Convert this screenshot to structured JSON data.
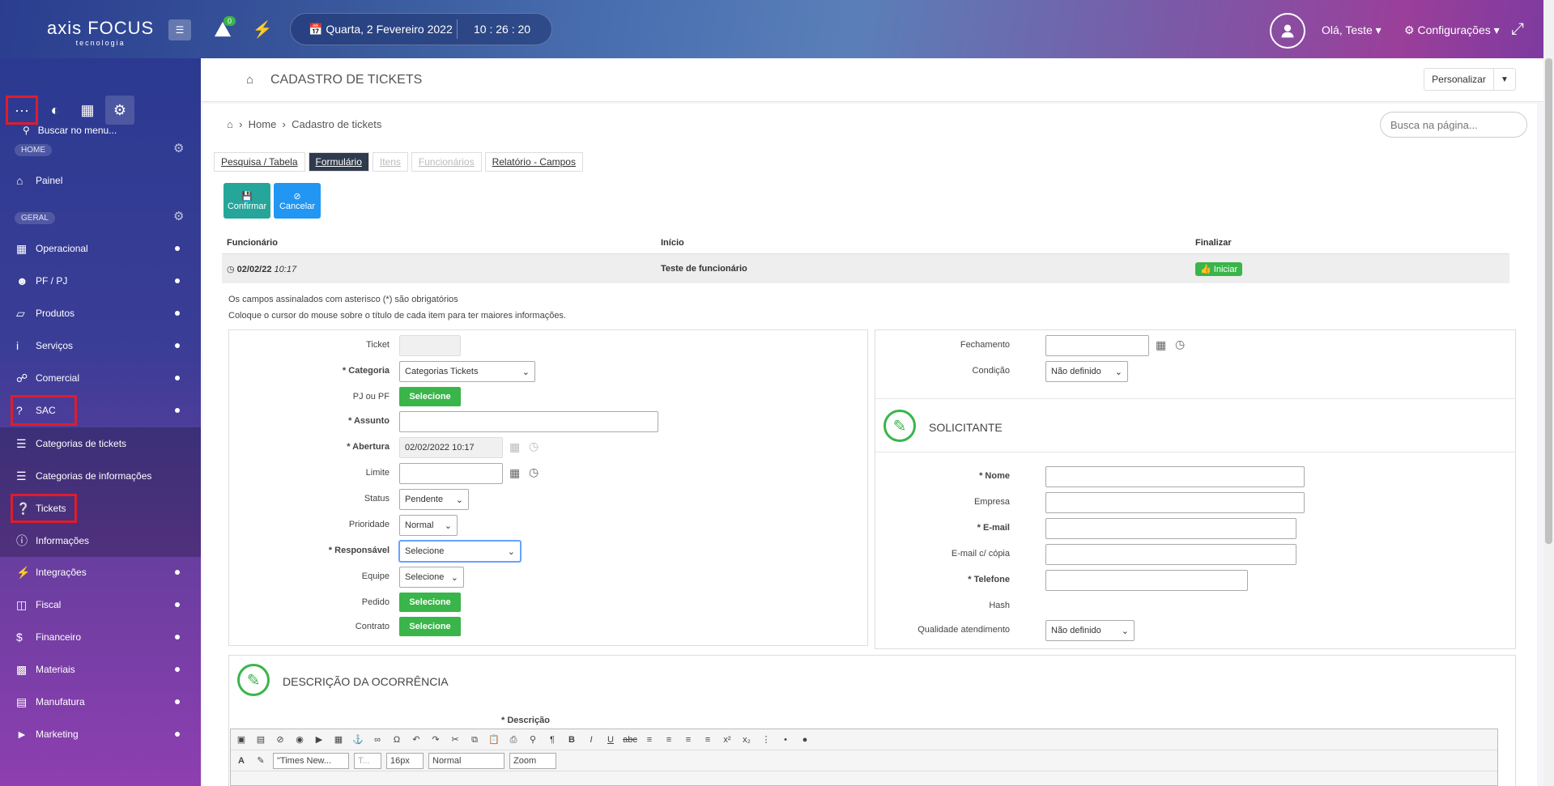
{
  "app": {
    "logo_main": "axis FOCUS",
    "logo_sub": "tecnologia",
    "notif_count": "0"
  },
  "topbar": {
    "date": "Quarta, 2 Fevereiro 2022",
    "time": "10 : 26 : 20",
    "user": "Olá, Teste ▾",
    "config": "Configurações ▾"
  },
  "sidebar": {
    "search": "Buscar no menu...",
    "home_label": "HOME",
    "geral_label": "GERAL",
    "items": [
      {
        "label": "Painel",
        "icon": "home-icon"
      },
      {
        "label": "Operacional",
        "icon": "calendar-icon"
      },
      {
        "label": "PF / PJ",
        "icon": "users-icon"
      },
      {
        "label": "Produtos",
        "icon": "cube-icon"
      },
      {
        "label": "Serviços",
        "icon": "info-icon"
      },
      {
        "label": "Comercial",
        "icon": "cart-icon"
      },
      {
        "label": "SAC",
        "icon": "question-icon"
      },
      {
        "label": "Categorias de tickets",
        "icon": "list-icon"
      },
      {
        "label": "Categorias de informações",
        "icon": "list-icon"
      },
      {
        "label": "Tickets",
        "icon": "question-circle-icon"
      },
      {
        "label": "Informações",
        "icon": "question-circle-icon"
      },
      {
        "label": "Integrações",
        "icon": "plug-icon"
      },
      {
        "label": "Fiscal",
        "icon": "folder-icon"
      },
      {
        "label": "Financeiro",
        "icon": "dollar-icon"
      },
      {
        "label": "Materiais",
        "icon": "cubes-icon"
      },
      {
        "label": "Manufatura",
        "icon": "factory-icon"
      },
      {
        "label": "Marketing",
        "icon": "megaphone-icon"
      }
    ]
  },
  "header": {
    "title": "CADASTRO DE TICKETS",
    "personalizar": "Personalizar",
    "search_placeholder": "Busca na página..."
  },
  "breadcrumb": {
    "home": "Home",
    "current": "Cadastro de tickets"
  },
  "tabs": [
    "Pesquisa / Tabela",
    "Formulário",
    "Itens",
    "Funcionários",
    "Relatório - Campos"
  ],
  "actions": {
    "confirm": "Confirmar",
    "cancel": "Cancelar"
  },
  "worktable": {
    "headers": [
      "Funcionário",
      "Início",
      "Finalizar"
    ],
    "row": {
      "date": "02/02/22",
      "time": "10:17",
      "name": "Teste de funcionário",
      "action": "Iniciar"
    }
  },
  "notes": [
    "Os campos assinalados com asterisco (*) são obrigatórios",
    "Coloque o cursor do mouse sobre o título de cada item para ter maiores informações."
  ],
  "form_left": {
    "ticket": "Ticket",
    "categoria": "* Categoria",
    "categoria_val": "Categorias Tickets",
    "pjpf": "PJ ou PF",
    "selecione": "Selecione",
    "assunto": "* Assunto",
    "abertura": "* Abertura",
    "abertura_val": "02/02/2022 10:17",
    "limite": "Limite",
    "status": "Status",
    "status_val": "Pendente",
    "prioridade": "Prioridade",
    "prioridade_val": "Normal",
    "responsavel": "* Responsável",
    "responsavel_val": "Selecione",
    "equipe": "Equipe",
    "equipe_val": "Selecione",
    "pedido": "Pedido",
    "contrato": "Contrato"
  },
  "form_right": {
    "fechamento": "Fechamento",
    "condicao": "Condição",
    "condicao_val": "Não definido",
    "solicitante": "SOLICITANTE",
    "nome": "* Nome",
    "empresa": "Empresa",
    "email": "* E-mail",
    "email_copia": "E-mail c/ cópia",
    "telefone": "* Telefone",
    "hash": "Hash",
    "qualidade": "Qualidade atendimento",
    "qualidade_val": "Não definido"
  },
  "descricao": {
    "title": "DESCRIÇÃO DA OCORRÊNCIA",
    "label": "* Descrição",
    "font": "\"Times New...",
    "size": "16px",
    "format": "Normal",
    "zoom": "Zoom"
  }
}
